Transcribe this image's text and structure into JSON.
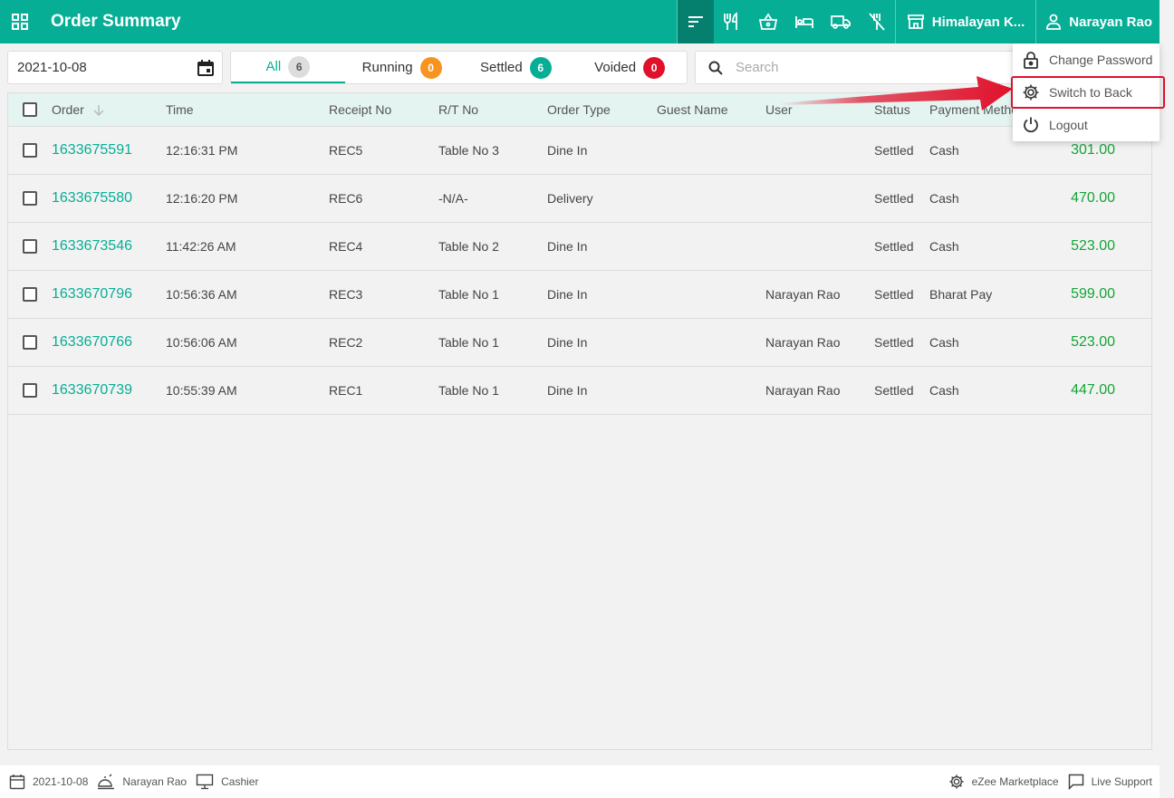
{
  "header": {
    "title": "Order Summary",
    "outlet": "Himalayan K...",
    "user": "Narayan Rao",
    "icons": [
      "grid-icon",
      "sort-icon",
      "restaurant-icon",
      "basket-icon",
      "bed-icon",
      "truck-icon",
      "no-fork-icon",
      "store-icon",
      "user-icon"
    ]
  },
  "filters": {
    "date": "2021-10-08",
    "tabs": [
      {
        "label": "All",
        "count": "6",
        "color": "#dddddd"
      },
      {
        "label": "Running",
        "count": "0",
        "color": "#f7931e"
      },
      {
        "label": "Settled",
        "count": "6",
        "color": "#06ae96"
      },
      {
        "label": "Voided",
        "count": "0",
        "color": "#e0112b"
      }
    ],
    "search_placeholder": "Search"
  },
  "table": {
    "columns": [
      "Order",
      "Time",
      "Receipt No",
      "R/T No",
      "Order Type",
      "Guest Name",
      "User",
      "Status",
      "Payment Method"
    ],
    "rows": [
      {
        "order": "1633675591",
        "time": "12:16:31 PM",
        "receipt": "REC5",
        "rt": "Table No 3",
        "type": "Dine In",
        "guest": "",
        "user": "",
        "status": "Settled",
        "payment": "Cash",
        "amount": "301.00"
      },
      {
        "order": "1633675580",
        "time": "12:16:20 PM",
        "receipt": "REC6",
        "rt": "-N/A-",
        "type": "Delivery",
        "guest": "",
        "user": "",
        "status": "Settled",
        "payment": "Cash",
        "amount": "470.00"
      },
      {
        "order": "1633673546",
        "time": "11:42:26 AM",
        "receipt": "REC4",
        "rt": "Table No 2",
        "type": "Dine In",
        "guest": "",
        "user": "",
        "status": "Settled",
        "payment": "Cash",
        "amount": "523.00"
      },
      {
        "order": "1633670796",
        "time": "10:56:36 AM",
        "receipt": "REC3",
        "rt": "Table No 1",
        "type": "Dine In",
        "guest": "",
        "user": "Narayan Rao",
        "status": "Settled",
        "payment": "Bharat Pay",
        "amount": "599.00"
      },
      {
        "order": "1633670766",
        "time": "10:56:06 AM",
        "receipt": "REC2",
        "rt": "Table No 1",
        "type": "Dine In",
        "guest": "",
        "user": "Narayan Rao",
        "status": "Settled",
        "payment": "Cash",
        "amount": "523.00"
      },
      {
        "order": "1633670739",
        "time": "10:55:39 AM",
        "receipt": "REC1",
        "rt": "Table No 1",
        "type": "Dine In",
        "guest": "",
        "user": "Narayan Rao",
        "status": "Settled",
        "payment": "Cash",
        "amount": "447.00"
      }
    ]
  },
  "dropdown": {
    "items": [
      {
        "label": "Change Password",
        "icon": "lock-icon"
      },
      {
        "label": "Switch to Back",
        "icon": "gear-icon"
      },
      {
        "label": "Logout",
        "icon": "power-icon"
      }
    ]
  },
  "footer": {
    "date": "2021-10-08",
    "user": "Narayan Rao",
    "role": "Cashier",
    "marketplace": "eZee Marketplace",
    "support": "Live Support"
  },
  "colors": {
    "brand": "#06ae96",
    "amount": "#13a538",
    "highlight": "#e0112b"
  }
}
